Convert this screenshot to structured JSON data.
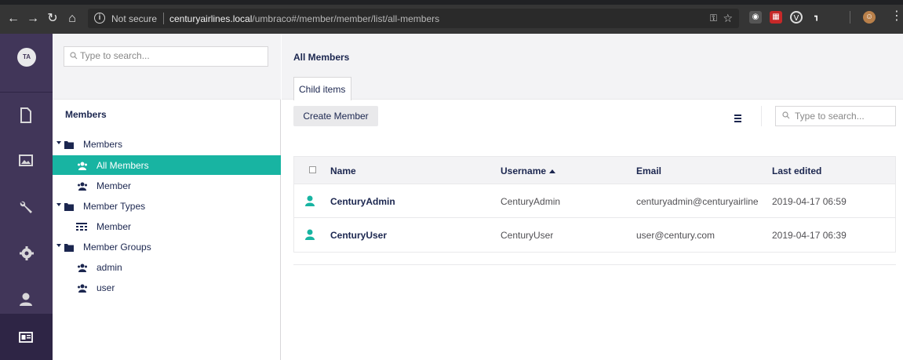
{
  "browser": {
    "not_secure": "Not secure",
    "url_host": "centuryairlines.local",
    "url_path": "/umbraco#/member/member/list/all-members"
  },
  "sections": {
    "avatar_initials": "TA",
    "items": [
      {
        "name": "content",
        "icon": "document-icon"
      },
      {
        "name": "media",
        "icon": "image-icon"
      },
      {
        "name": "settings",
        "icon": "wrench-icon"
      },
      {
        "name": "developer",
        "icon": "gear-icon"
      },
      {
        "name": "users",
        "icon": "user-icon"
      },
      {
        "name": "members",
        "icon": "id-card-icon",
        "active": true
      }
    ]
  },
  "tree": {
    "search_placeholder": "Type to search...",
    "title": "Members",
    "nodes": [
      {
        "label": "Members",
        "icon": "folder-icon",
        "expanded": true
      },
      {
        "label": "All Members",
        "icon": "users-icon",
        "selected": true
      },
      {
        "label": "Member",
        "icon": "users-icon"
      },
      {
        "label": "Member Types",
        "icon": "folder-icon",
        "expanded": true
      },
      {
        "label": "Member",
        "icon": "grid-icon"
      },
      {
        "label": "Member Groups",
        "icon": "folder-icon",
        "expanded": true
      },
      {
        "label": "admin",
        "icon": "users-icon"
      },
      {
        "label": "user",
        "icon": "users-icon"
      }
    ]
  },
  "main": {
    "title": "All Members",
    "tab_label": "Child items",
    "create_button": "Create Member",
    "search_placeholder": "Type to search...",
    "columns": {
      "name": "Name",
      "username": "Username",
      "email": "Email",
      "last_edited": "Last edited"
    },
    "rows": [
      {
        "name": "CenturyAdmin",
        "username": "CenturyAdmin",
        "email": "centuryadmin@centuryairline",
        "last_edited": "2019-04-17 06:59"
      },
      {
        "name": "CenturyUser",
        "username": "CenturyUser",
        "email": "user@century.com",
        "last_edited": "2019-04-17 06:39"
      }
    ]
  },
  "colors": {
    "sections_bg": "#413659",
    "selected_node": "#18b4a2",
    "text": "#1b264f"
  }
}
